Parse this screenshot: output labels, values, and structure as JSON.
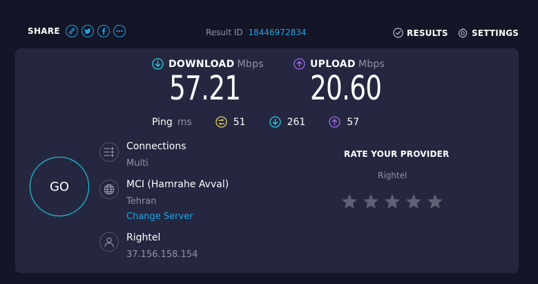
{
  "header": {
    "share_label": "SHARE",
    "share_icons": [
      "link-icon",
      "twitter-icon",
      "facebook-icon",
      "more-icon"
    ],
    "result_id_label": "Result ID",
    "result_id": "18446972834",
    "results_label": "RESULTS",
    "settings_label": "SETTINGS"
  },
  "download": {
    "label": "DOWNLOAD",
    "unit": "Mbps",
    "value": "57.21"
  },
  "upload": {
    "label": "UPLOAD",
    "unit": "Mbps",
    "value": "20.60"
  },
  "ping": {
    "label": "Ping",
    "unit": "ms",
    "idle": "51",
    "download": "261",
    "upload": "57"
  },
  "go_label": "GO",
  "connections": {
    "title": "Connections",
    "value": "Multi"
  },
  "server": {
    "title": "MCI (Hamrahe Avval)",
    "location": "Tehran",
    "change_label": "Change Server"
  },
  "provider": {
    "name": "Rightel",
    "ip": "37.156.158.154"
  },
  "rating": {
    "title": "RATE YOUR PROVIDER",
    "provider": "Rightel",
    "stars_total": 5,
    "stars_filled": 0
  },
  "colors": {
    "background": "#141526",
    "panel": "#252740",
    "accent_blue": "#1ea5e8",
    "download_cyan": "#21d1e3",
    "upload_purple": "#a56cf0",
    "ping_yellow": "#e9d35a",
    "muted": "#9193a8"
  }
}
